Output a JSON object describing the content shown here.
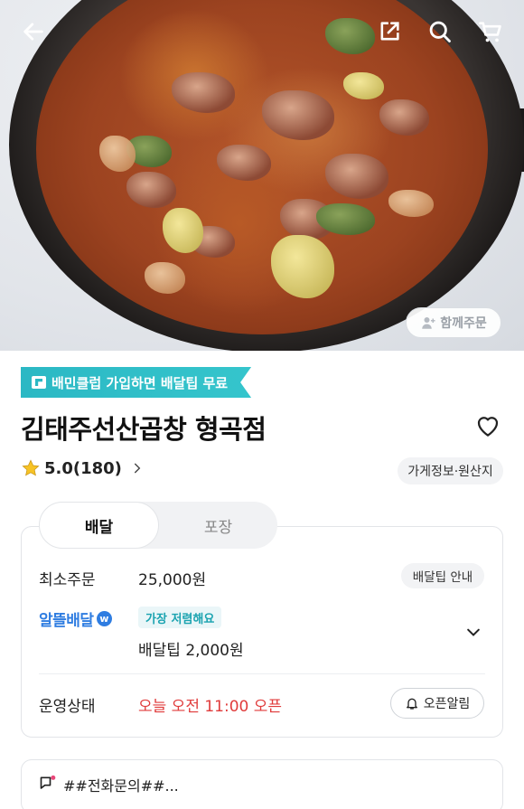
{
  "hero": {
    "image_alt": "곱창전골",
    "together_order_label": "함께주문"
  },
  "club_banner": {
    "text": "배민클럽 가입하면 배달팁 무료"
  },
  "store": {
    "name": "김태주선산곱창 형곡점",
    "rating": "5.0(180)",
    "info_chip": "가게정보·원산지"
  },
  "tabs": [
    {
      "label": "배달",
      "active": true
    },
    {
      "label": "포장",
      "active": false
    }
  ],
  "delivery": {
    "min_order_label": "최소주문",
    "min_order_value": "25,000원",
    "tip_info_label": "배달팁 안내",
    "service_name": "알뜰배달",
    "service_badge": "가장 저렴해요",
    "tip_value": "배달팁 2,000원",
    "status_label": "운영상태",
    "status_value": "오늘 오전 11:00 오픈",
    "notify_label": "오픈알림"
  },
  "notice": {
    "text": "##전화문의##..."
  },
  "colors": {
    "accent_teal": "#2bb8c4",
    "alttle_blue": "#2f7de1",
    "open_red": "#e03b3b"
  }
}
